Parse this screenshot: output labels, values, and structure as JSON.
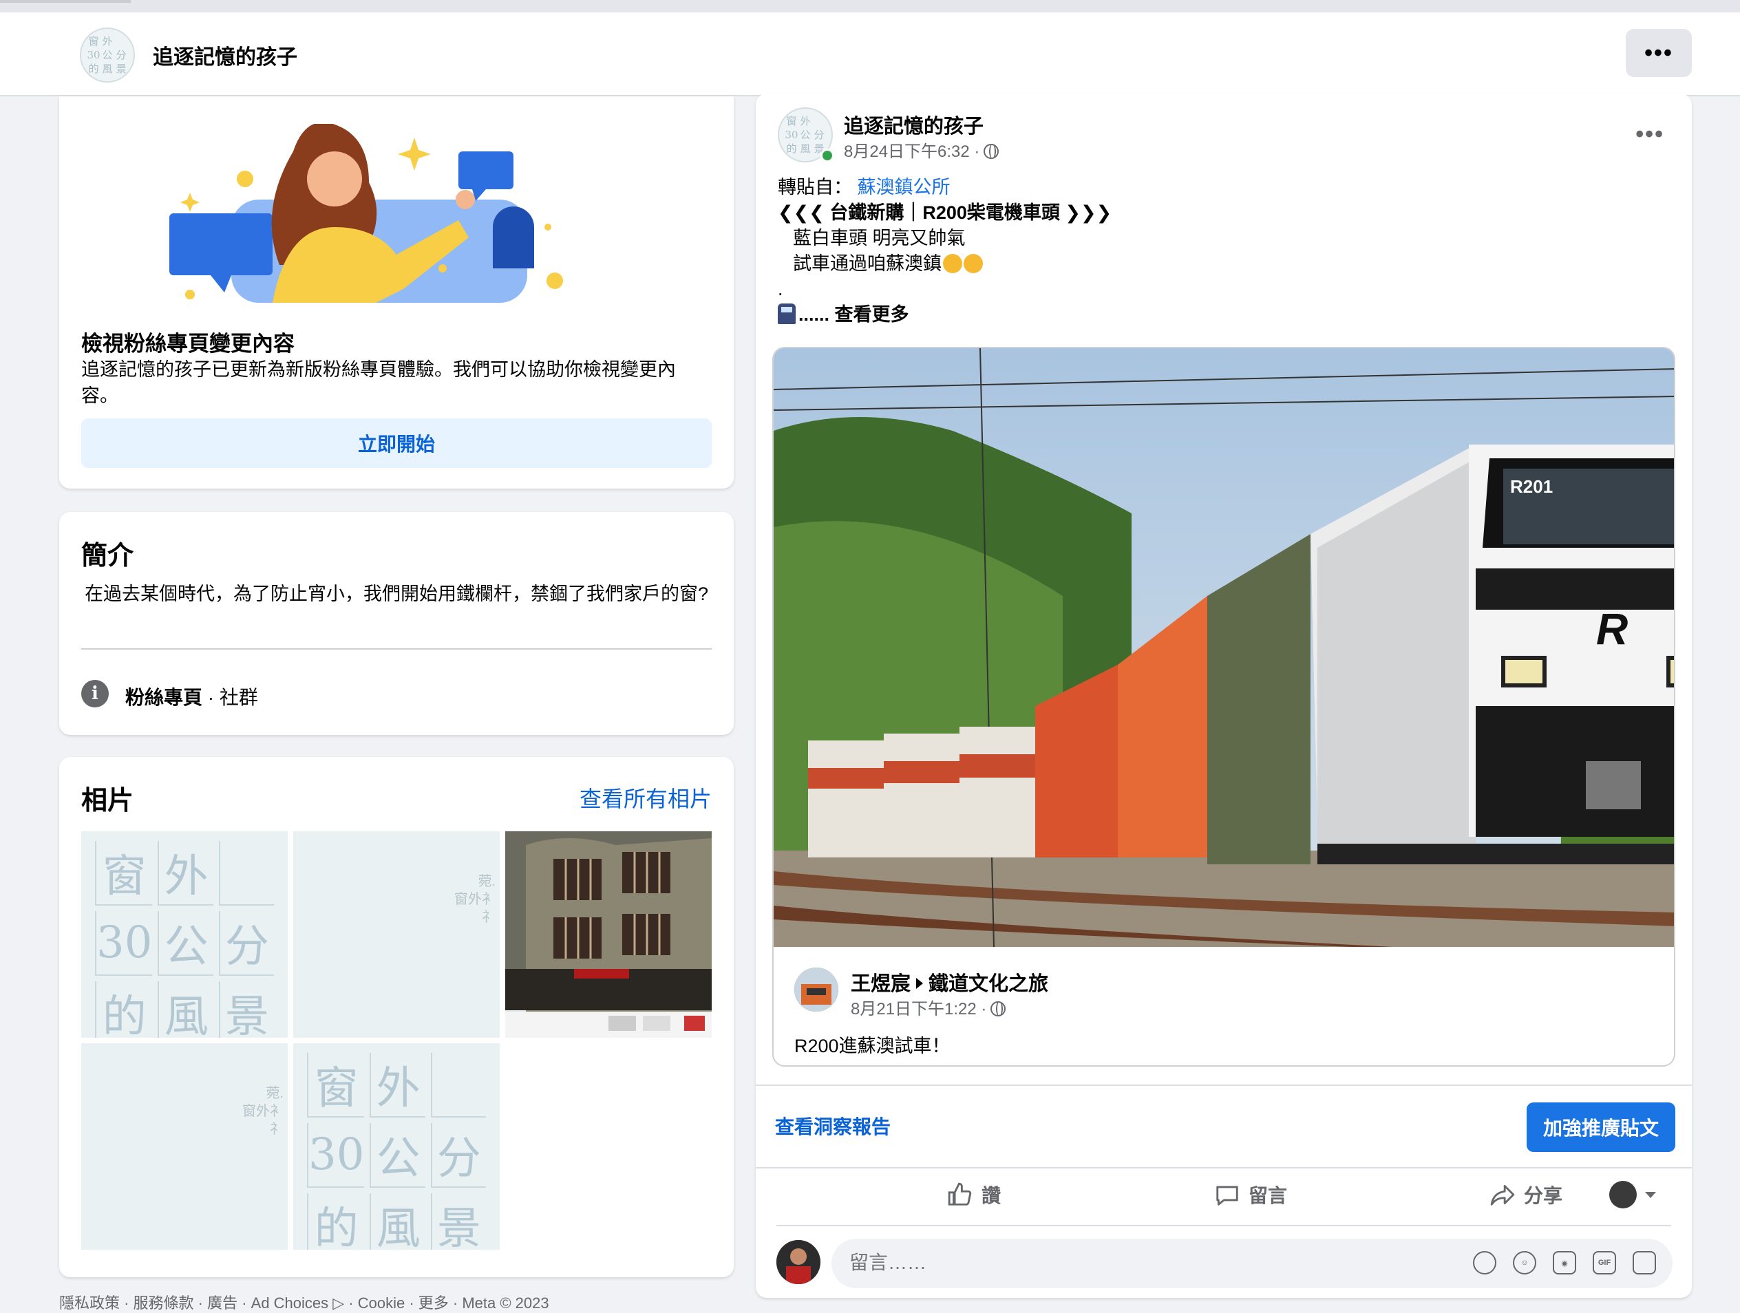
{
  "page": {
    "name": "追逐記憶的孩子",
    "logo_chars": [
      "窗",
      "外",
      "",
      "30",
      "公",
      "分",
      "的",
      "風",
      "景"
    ]
  },
  "header": {
    "more_label": "•••"
  },
  "notice_card": {
    "title": "檢視粉絲專頁變更內容",
    "description": "追逐記憶的孩子已更新為新版粉絲專頁體驗。我們可以協助你檢視變更內容。",
    "button_label": "立即開始"
  },
  "intro_card": {
    "title": "簡介",
    "description": "在過去某個時代，為了防止宵小，我們開始用鐵欄杆，禁錮了我們家戶的窗?",
    "category_bold": "粉絲專頁",
    "category_rest": " · 社群"
  },
  "photos_card": {
    "title": "相片",
    "see_all": "查看所有相片",
    "photos": [
      {
        "type": "logo",
        "chars": [
          "窗",
          "外",
          "",
          "30",
          "公",
          "分",
          "的",
          "風",
          "景"
        ]
      },
      {
        "type": "faint",
        "text": [
          "菀.",
          "窗外衤",
          "礻"
        ]
      },
      {
        "type": "building"
      },
      {
        "type": "faint",
        "text": [
          "菀.",
          "窗外衤",
          "礻"
        ]
      },
      {
        "type": "logo",
        "chars": [
          "窗",
          "外",
          "",
          "30",
          "公",
          "分",
          "的",
          "風",
          "景"
        ]
      }
    ]
  },
  "footer": {
    "links": "隱私政策 · 服務條款 · 廣告 · Ad Choices ▷ · Cookie · 更多 · Meta © 2023"
  },
  "post": {
    "author": "追逐記憶的孩子",
    "time": "8月24日下午6:32 ·",
    "more_label": "•••",
    "shared_from_prefix": "轉貼自：",
    "shared_from_link": "蘇澳鎮公所",
    "line1": "❮❮❮ 台鐵新購｜R200柴電機車頭 ❯❯❯",
    "line2": "藍白車頭 明亮又帥氣",
    "line3": "試車通過咱蘇澳鎮",
    "line4": ".",
    "line5": "...... 查看更多",
    "shared": {
      "author": "王煜宸",
      "group": "鐵道文化之旅",
      "time": "8月21日下午1:22 ·",
      "text": "R200進蘇澳試車！",
      "locomotive_number": "R201",
      "locomotive_logo": "R"
    },
    "insights": "查看洞察報告",
    "boost": "加強推廣貼文",
    "actions": {
      "like": "讚",
      "comment": "留言",
      "share": "分享"
    },
    "comment_placeholder": "留言……",
    "comment_icons": [
      "sticker-icon",
      "emoji-icon",
      "camera-icon",
      "gif-icon",
      "avatar-sticker-icon"
    ]
  }
}
